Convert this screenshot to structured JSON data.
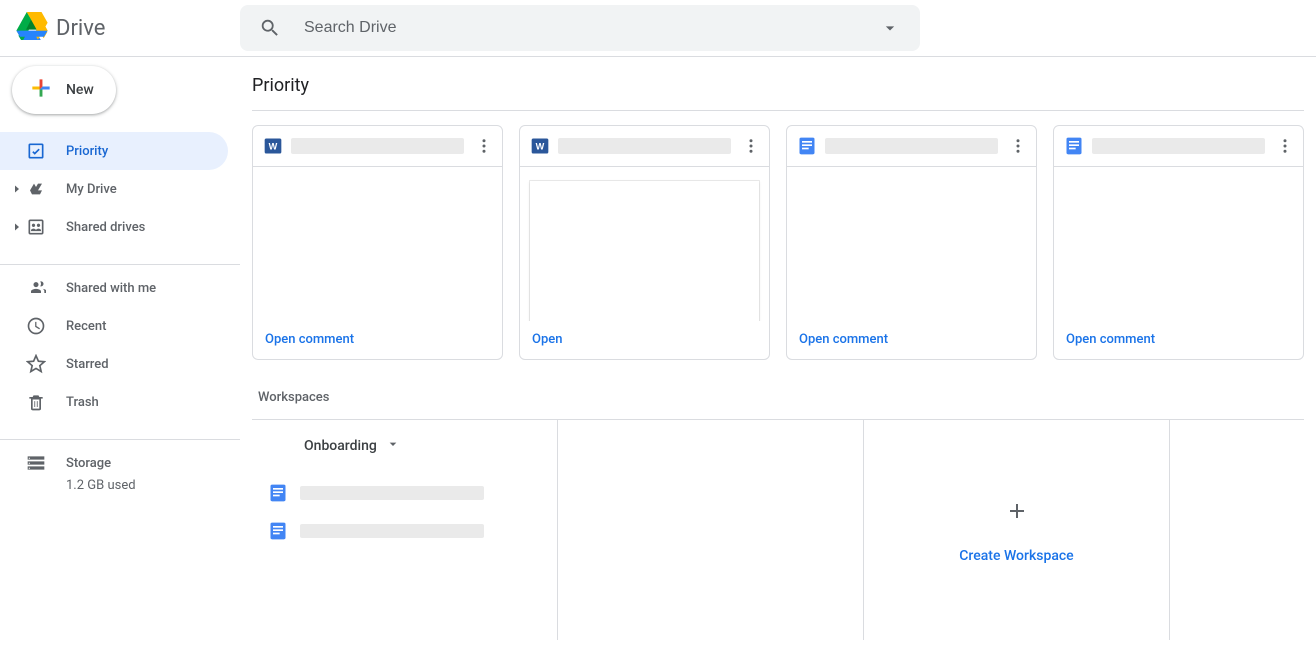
{
  "app": {
    "name": "Drive"
  },
  "search": {
    "placeholder": "Search Drive"
  },
  "new_button": {
    "label": "New"
  },
  "sidebar": {
    "priority": "Priority",
    "my_drive": "My Drive",
    "shared_drives": "Shared drives",
    "shared_with_me": "Shared with me",
    "recent": "Recent",
    "starred": "Starred",
    "trash": "Trash",
    "storage": "Storage",
    "storage_used": "1.2 GB used"
  },
  "main": {
    "title": "Priority",
    "cards": [
      {
        "icon": "word",
        "action": "Open comment"
      },
      {
        "icon": "word",
        "action": "Open",
        "preview_page": true
      },
      {
        "icon": "docs",
        "action": "Open comment"
      },
      {
        "icon": "docs",
        "action": "Open comment"
      }
    ],
    "workspaces_title": "Workspaces",
    "workspaces": [
      {
        "name": "Onboarding",
        "files": [
          {
            "icon": "docs"
          },
          {
            "icon": "docs"
          }
        ]
      }
    ],
    "create_workspace": "Create Workspace"
  }
}
